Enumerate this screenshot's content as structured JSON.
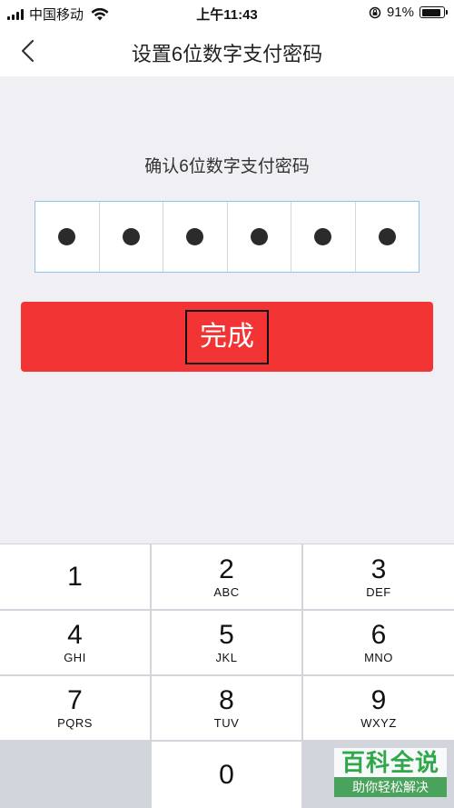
{
  "status_bar": {
    "carrier": "中国移动",
    "time": "上午11:43",
    "battery_pct": "91%",
    "battery_level": 0.91
  },
  "nav": {
    "title": "设置6位数字支付密码",
    "back_icon": "chevron-left-icon"
  },
  "prompt": "确认6位数字支付密码",
  "pin": {
    "length": 6,
    "filled": 6
  },
  "done_button": {
    "label": "完成",
    "color": "#f23434"
  },
  "keypad": {
    "keys": [
      {
        "num": "1",
        "letters": ""
      },
      {
        "num": "2",
        "letters": "ABC"
      },
      {
        "num": "3",
        "letters": "DEF"
      },
      {
        "num": "4",
        "letters": "GHI"
      },
      {
        "num": "5",
        "letters": "JKL"
      },
      {
        "num": "6",
        "letters": "MNO"
      },
      {
        "num": "7",
        "letters": "PQRS"
      },
      {
        "num": "8",
        "letters": "TUV"
      },
      {
        "num": "9",
        "letters": "WXYZ"
      },
      {
        "num": "0",
        "letters": ""
      }
    ]
  },
  "watermark": {
    "title": "百科全说",
    "subtitle": "助你轻松解决",
    "color": "#2fa84a"
  }
}
